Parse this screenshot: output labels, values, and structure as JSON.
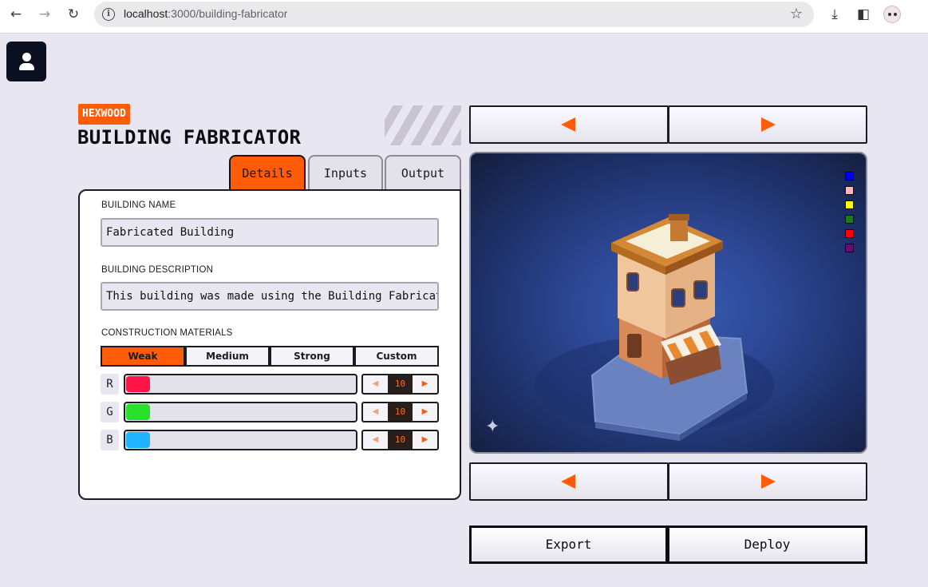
{
  "browser": {
    "url_host": "localhost",
    "url_path": ":3000/building-fabricator"
  },
  "header": {
    "brand": "HEXWOOD",
    "title": "BUILDING FABRICATOR"
  },
  "tabs": [
    {
      "label": "Details",
      "active": true
    },
    {
      "label": "Inputs",
      "active": false
    },
    {
      "label": "Output",
      "active": false
    }
  ],
  "details": {
    "name_label": "BUILDING NAME",
    "name_value": "Fabricated Building",
    "description_label": "BUILDING DESCRIPTION",
    "description_value": "This building was made using the Building Fabricator!",
    "materials_label": "CONSTRUCTION MATERIALS",
    "materials": [
      {
        "label": "Weak",
        "active": true
      },
      {
        "label": "Medium",
        "active": false
      },
      {
        "label": "Strong",
        "active": false
      },
      {
        "label": "Custom",
        "active": false
      }
    ],
    "rgb": [
      {
        "letter": "R",
        "value": "10",
        "color": "#ff1448"
      },
      {
        "letter": "G",
        "value": "10",
        "color": "#29e02c"
      },
      {
        "letter": "B",
        "value": "10",
        "color": "#1fb4ff"
      }
    ]
  },
  "preview": {
    "swatches": [
      "#0000ff",
      "#ffb6c1",
      "#ffff00",
      "#1e7a1e",
      "#ff0000",
      "#6a0d6a"
    ]
  },
  "actions": {
    "export_label": "Export",
    "deploy_label": "Deploy"
  },
  "colors": {
    "accent": "#ff5c0a",
    "background": "#e8e6f0"
  }
}
